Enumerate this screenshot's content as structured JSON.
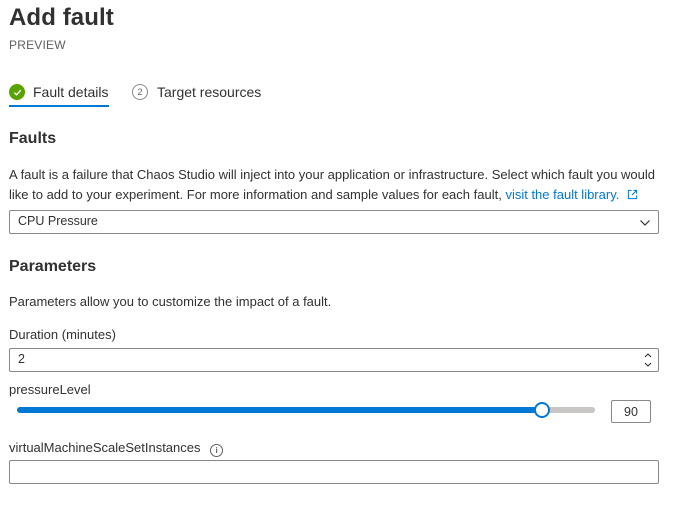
{
  "header": {
    "title": "Add fault",
    "subtitle": "PREVIEW"
  },
  "tabs": [
    {
      "label": "Fault details",
      "state": "completed",
      "icon": "check-circle-icon"
    },
    {
      "label": "Target resources",
      "step_number": "2",
      "icon": "step-number-icon"
    }
  ],
  "faults": {
    "heading": "Faults",
    "description_line1": "A fault is a failure that Chaos Studio will inject into your application or infrastructure. Select which fault you would",
    "description_line2": "like to add to your experiment. For more information and sample values for each fault,",
    "link_text": "visit the fault library.",
    "link_icon": "external-link-icon",
    "selected_fault": "CPU Pressure"
  },
  "parameters": {
    "heading": "Parameters",
    "description": "Parameters allow you to customize the impact of a fault.",
    "duration": {
      "label": "Duration (minutes)",
      "value": "2"
    },
    "pressure_level": {
      "label": "pressureLevel",
      "value": 90,
      "min": 0,
      "max": 99,
      "display": "90"
    },
    "vmss_instances": {
      "label": "virtualMachineScaleSetInstances",
      "value": "",
      "info_icon": "info-icon"
    }
  },
  "colors": {
    "accent": "#0078d4",
    "success": "#57a300",
    "border": "#8a8886",
    "text": "#323130",
    "muted": "#605e5c"
  }
}
